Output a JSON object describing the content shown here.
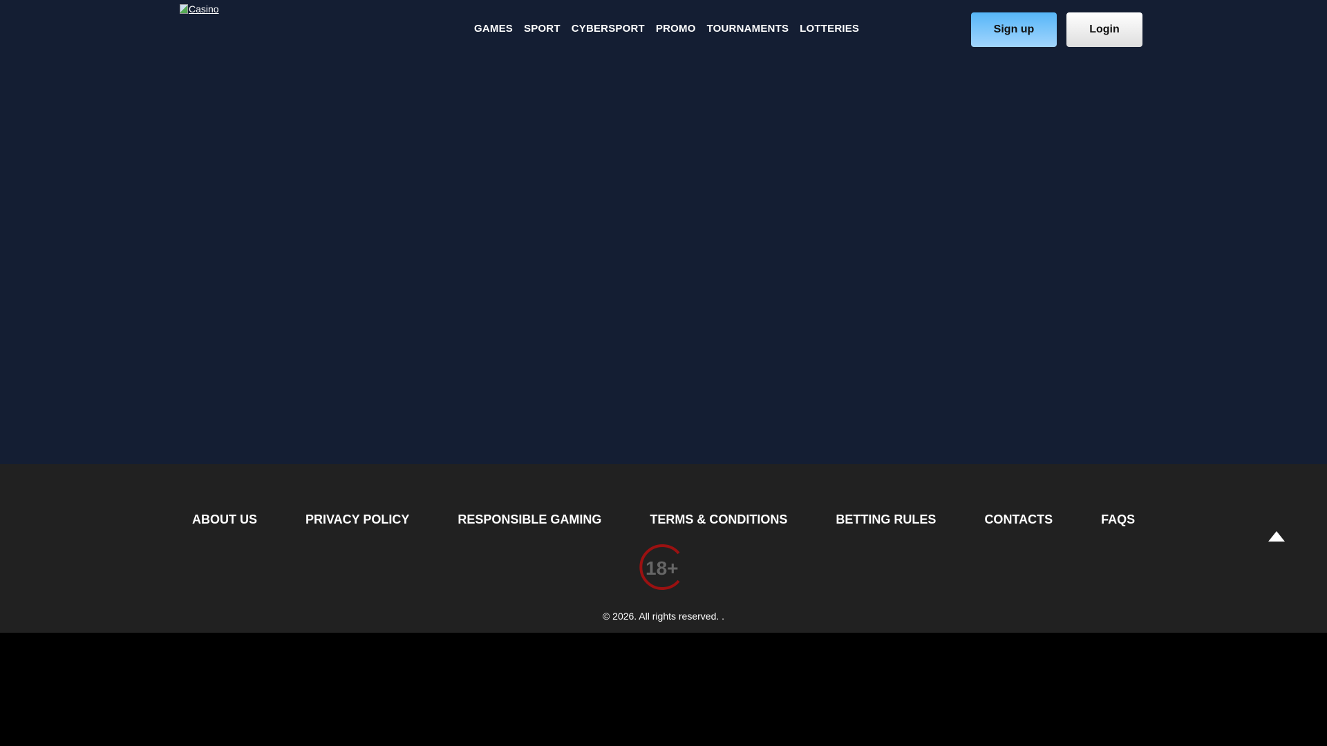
{
  "header": {
    "logo_alt": "Casino",
    "nav": [
      "GAMES",
      "SPORT",
      "CYBERSPORT",
      "PROMO",
      "TOURNAMENTS",
      "LOTTERIES"
    ],
    "signup": "Sign up",
    "login": "Login"
  },
  "footer": {
    "links": [
      "ABOUT US",
      "PRIVACY POLICY",
      "RESPONSIBLE GAMING",
      "TERMS & CONDITIONS",
      "BETTING RULES",
      "CONTACTS",
      "FAQS"
    ],
    "age_badge": "18+",
    "copyright": "© 2026. All rights reserved. ."
  },
  "colors": {
    "main_bg": "#141e33",
    "footer_bg": "#212121",
    "signup": "#56b6f8",
    "age_ring": "#9b1111"
  }
}
